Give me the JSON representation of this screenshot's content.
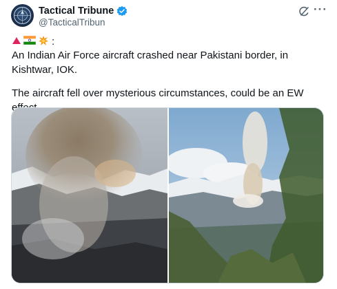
{
  "account": {
    "display_name": "Tactical Tribune",
    "handle": "@TacticalTribun"
  },
  "icons": {
    "verified": "verified-badge-icon",
    "grok": "grok-icon",
    "more": "more-options-icon",
    "emojis": [
      "red-triangle-icon",
      "india-flag-icon",
      "collision-icon"
    ]
  },
  "post": {
    "emoji_suffix": ":",
    "line1": "An Indian Air Force aircraft crashed near Pakistani border, in Kishtwar, IOK.",
    "line2": "The aircraft fell over mysterious circumstances, could be an EW effect."
  },
  "media": {
    "images": [
      "smoke-over-mountains-photo-left",
      "smoke-over-mountains-photo-right"
    ]
  },
  "colors": {
    "verified_blue": "#1d9bf0",
    "secondary_text": "#536471",
    "border": "#cfd9de"
  }
}
